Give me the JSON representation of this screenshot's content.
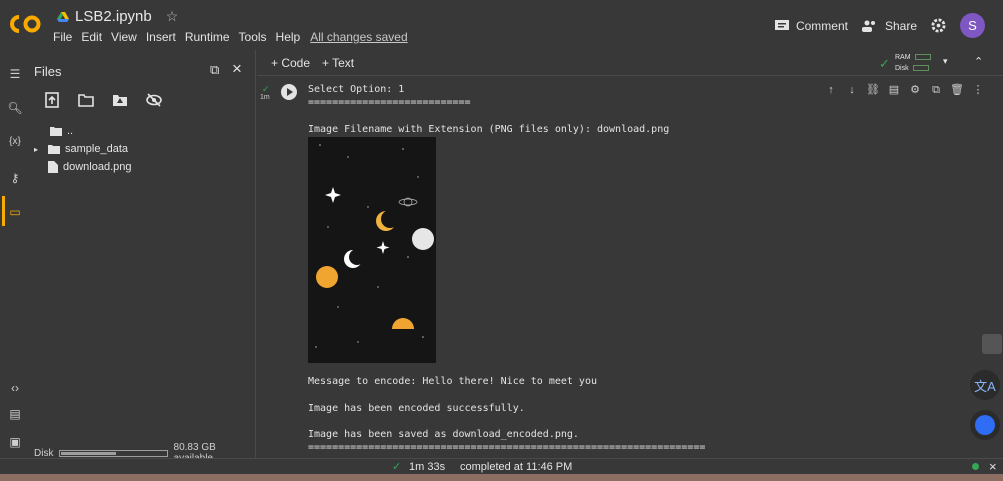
{
  "app": {
    "notebook_name": "LSB2.ipynb",
    "menu": [
      "File",
      "Edit",
      "View",
      "Insert",
      "Runtime",
      "Tools",
      "Help"
    ],
    "saved_status": "All changes saved"
  },
  "header": {
    "comment_label": "Comment",
    "share_label": "Share",
    "avatar_letter": "S"
  },
  "sidebar": {
    "title": "Files",
    "tree": [
      {
        "name": ".."
      },
      {
        "name": "sample_data"
      },
      {
        "name": "download.png"
      }
    ],
    "disk_label": "Disk",
    "disk_available": "80.83 GB available",
    "disk_used_fraction": 0.5
  },
  "toolbar": {
    "code_label": "+ Code",
    "text_label": "+ Text",
    "ram_label": "RAM",
    "disk_label": "Disk"
  },
  "cell": {
    "exec_label": "1m",
    "output": "Select Option: 1\n===========================\n\nImage Filename with Extension (PNG files only): download.png",
    "output2": "Message to encode: Hello there! Nice to meet you\n\nImage has been encoded successfully.\n\nImage has been saved as download_encoded.png.\n=================================================================="
  },
  "status": {
    "duration": "1m 33s",
    "completed": "completed at 11:46 PM"
  },
  "colors": {
    "background": "#383838",
    "accent": "#f9ab00",
    "avatar": "#7e57c2",
    "ok_green": "#34a853"
  }
}
